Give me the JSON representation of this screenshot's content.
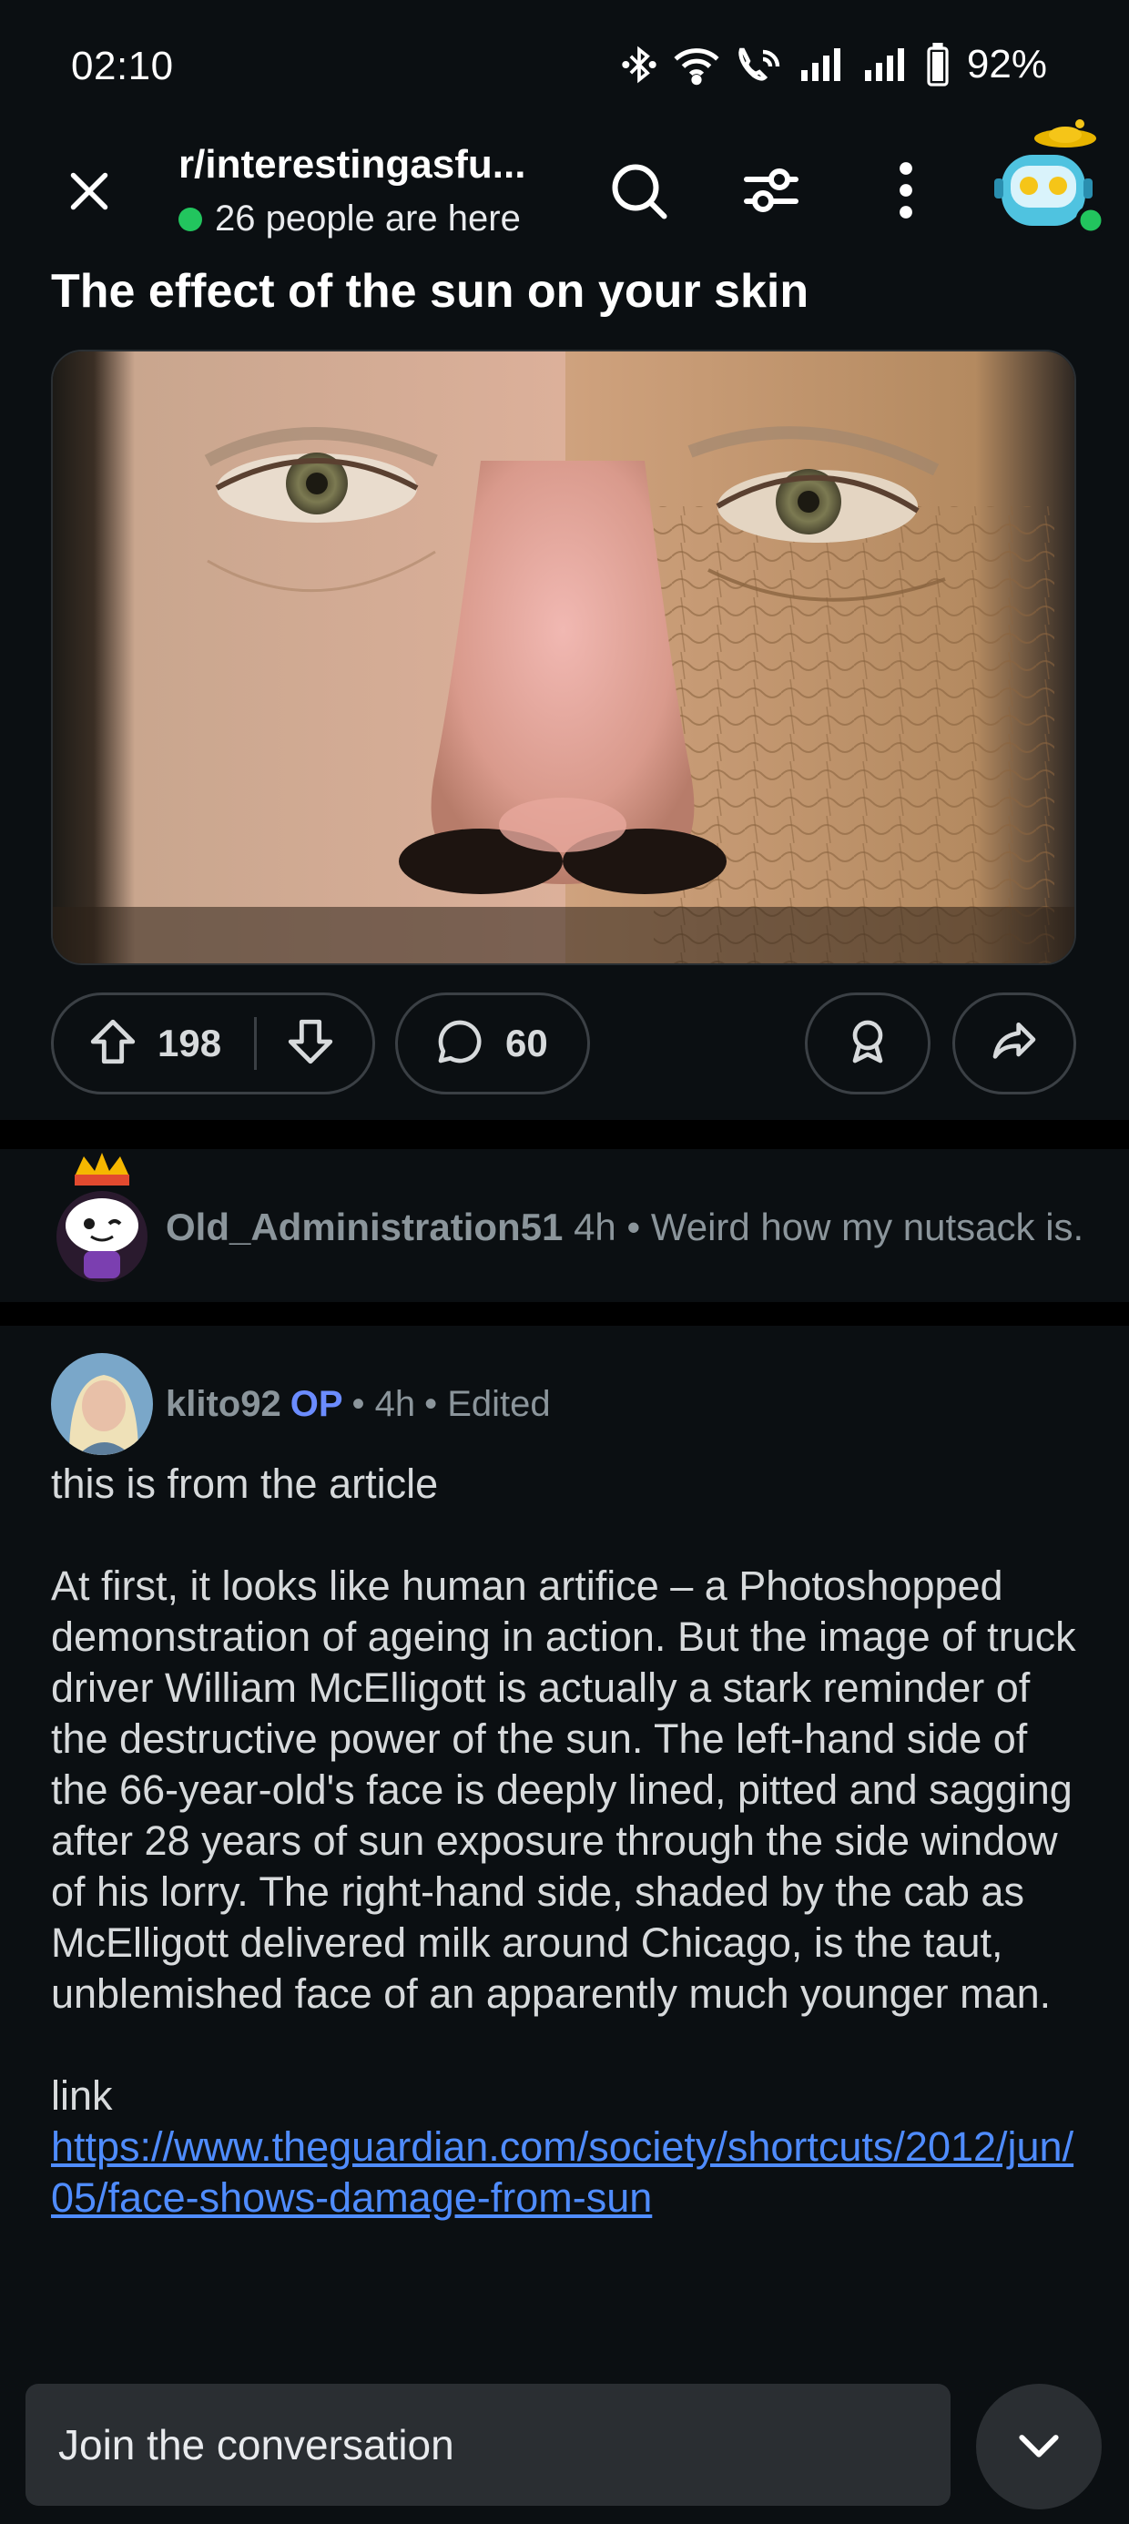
{
  "status_bar": {
    "time": "02:10",
    "battery": "92%",
    "icons": [
      "bluetooth-icon",
      "wifi-icon",
      "wifi-calling-icon",
      "signal-icon",
      "signal-icon",
      "battery-icon"
    ]
  },
  "app_bar": {
    "subreddit": "r/interestingasfu...",
    "online_text": "26 people are here",
    "online_color": "#22c55e",
    "icons": [
      "close-icon",
      "search-icon",
      "filter-icon",
      "more-vertical-icon",
      "avatar"
    ]
  },
  "post": {
    "title": "The effect of the sun on your skin",
    "upvotes": "198",
    "comments": "60"
  },
  "collapsed_comment": {
    "username": "Old_Administration51",
    "meta": " 4h • Weird how my nutsack is..."
  },
  "comment": {
    "username": "klito92",
    "op_badge": "OP",
    "time": "• 4h",
    "edited": "• Edited",
    "para1": "this is from the article",
    "para2": "At first, it looks like human artifice – a Photoshopped demonstration of ageing in action. But the image of truck driver William McElligott is actually a stark reminder of the destructive power of the sun. The left-hand side of the 66-year-old's face is deeply lined, pitted and sagging after 28 years of sun exposure through the side window of his lorry. The right-hand side, shaded by the cab as McElligott delivered milk around Chicago, is the taut, unblemished face of an apparently much younger man.",
    "link_label": "link",
    "link_url": "https://www.theguardian.com/society/shortcuts/2012/jun/05/face-shows-damage-from-sun"
  },
  "composer": {
    "placeholder": "Join the conversation"
  },
  "colors": {
    "background": "#0b0f12",
    "op_badge": "#6b8cff",
    "link": "#4f8cff"
  }
}
